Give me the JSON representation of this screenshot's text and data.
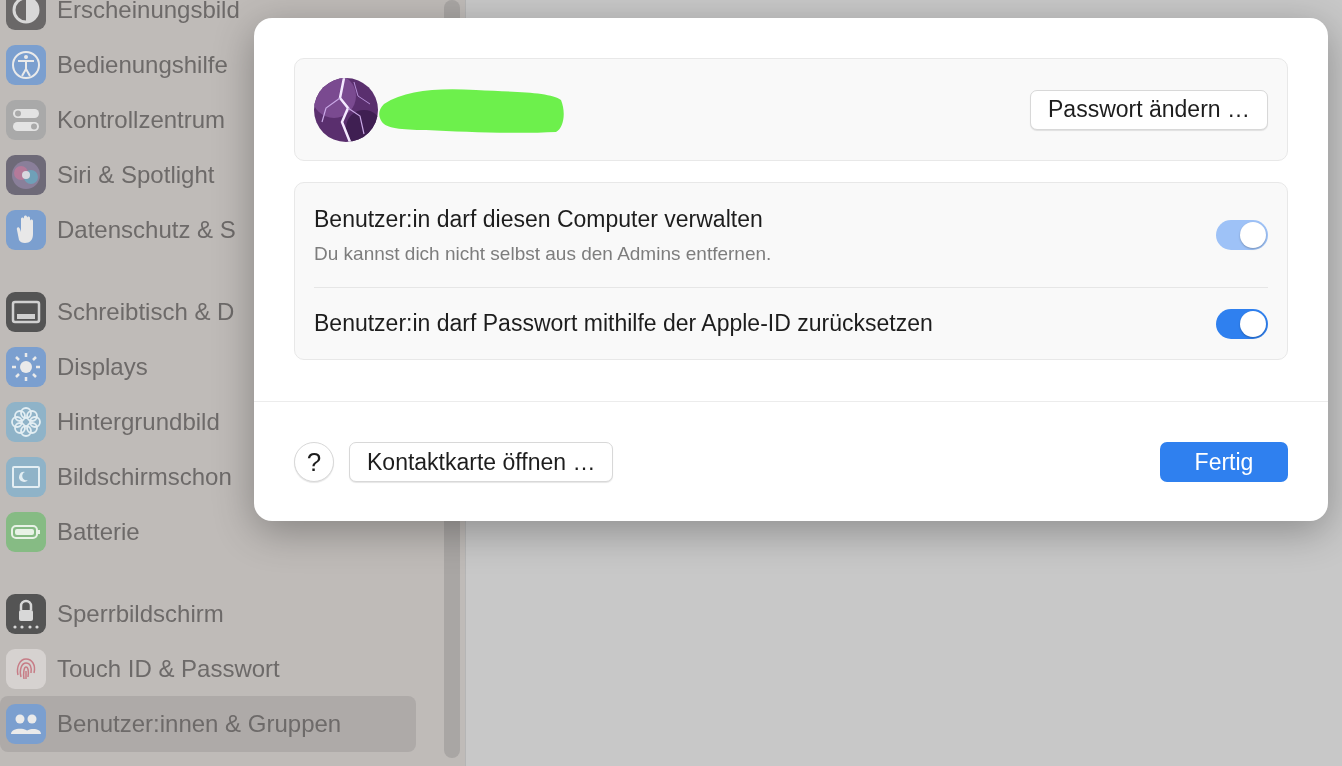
{
  "sidebar": {
    "groups": [
      {
        "items": [
          {
            "label": "Erscheinungsbild",
            "selected": false
          },
          {
            "label": "Bedienungshilfe",
            "selected": false
          },
          {
            "label": "Kontrollzentrum",
            "selected": false
          },
          {
            "label": "Siri & Spotlight",
            "selected": false
          },
          {
            "label": "Datenschutz & S",
            "selected": false
          }
        ]
      },
      {
        "items": [
          {
            "label": "Schreibtisch & D",
            "selected": false
          },
          {
            "label": "Displays",
            "selected": false
          },
          {
            "label": "Hintergrundbild",
            "selected": false
          },
          {
            "label": "Bildschirmschon",
            "selected": false
          },
          {
            "label": "Batterie",
            "selected": false
          }
        ]
      },
      {
        "items": [
          {
            "label": "Sperrbildschirm",
            "selected": false
          },
          {
            "label": "Touch ID & Passwort",
            "selected": false
          },
          {
            "label": "Benutzer:innen & Gruppen",
            "selected": true
          }
        ]
      }
    ]
  },
  "dialog": {
    "account": {
      "password_button": "Passwort ändern …"
    },
    "options": [
      {
        "label": "Benutzer:in darf diesen Computer verwalten",
        "note": "Du kannst dich nicht selbst aus den Admins entfernen.",
        "on": true,
        "disabled": true
      },
      {
        "label": "Benutzer:in darf Passwort mithilfe der Apple-ID zurücksetzen",
        "on": true,
        "disabled": false
      }
    ],
    "footer": {
      "help": "?",
      "contact_button": "Kontaktkarte öffnen …",
      "done_button": "Fertig"
    }
  }
}
